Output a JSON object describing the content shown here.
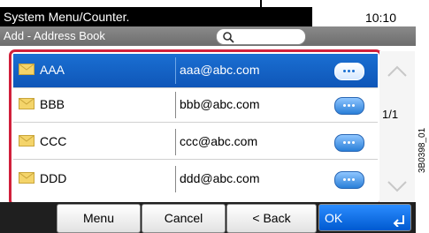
{
  "status_bar": {
    "left_text": "System Menu/Counter.",
    "time": "10:10"
  },
  "title_bar": {
    "title": "Add - Address Book"
  },
  "address_list": {
    "rows": [
      {
        "name": "AAA",
        "email": "aaa@abc.com",
        "selected": true
      },
      {
        "name": "BBB",
        "email": "bbb@abc.com",
        "selected": false
      },
      {
        "name": "CCC",
        "email": "ccc@abc.com",
        "selected": false
      },
      {
        "name": "DDD",
        "email": "ddd@abc.com",
        "selected": false
      }
    ]
  },
  "pager": {
    "page_count": "1/1"
  },
  "bottom_buttons": {
    "menu": "Menu",
    "cancel": "Cancel",
    "back": "< Back",
    "ok": "OK"
  },
  "figure_id": "3B0398_01",
  "colors": {
    "highlight_border": "#d1203b",
    "selected_row": "#1a6fd2",
    "ok_button": "#005ad0"
  }
}
